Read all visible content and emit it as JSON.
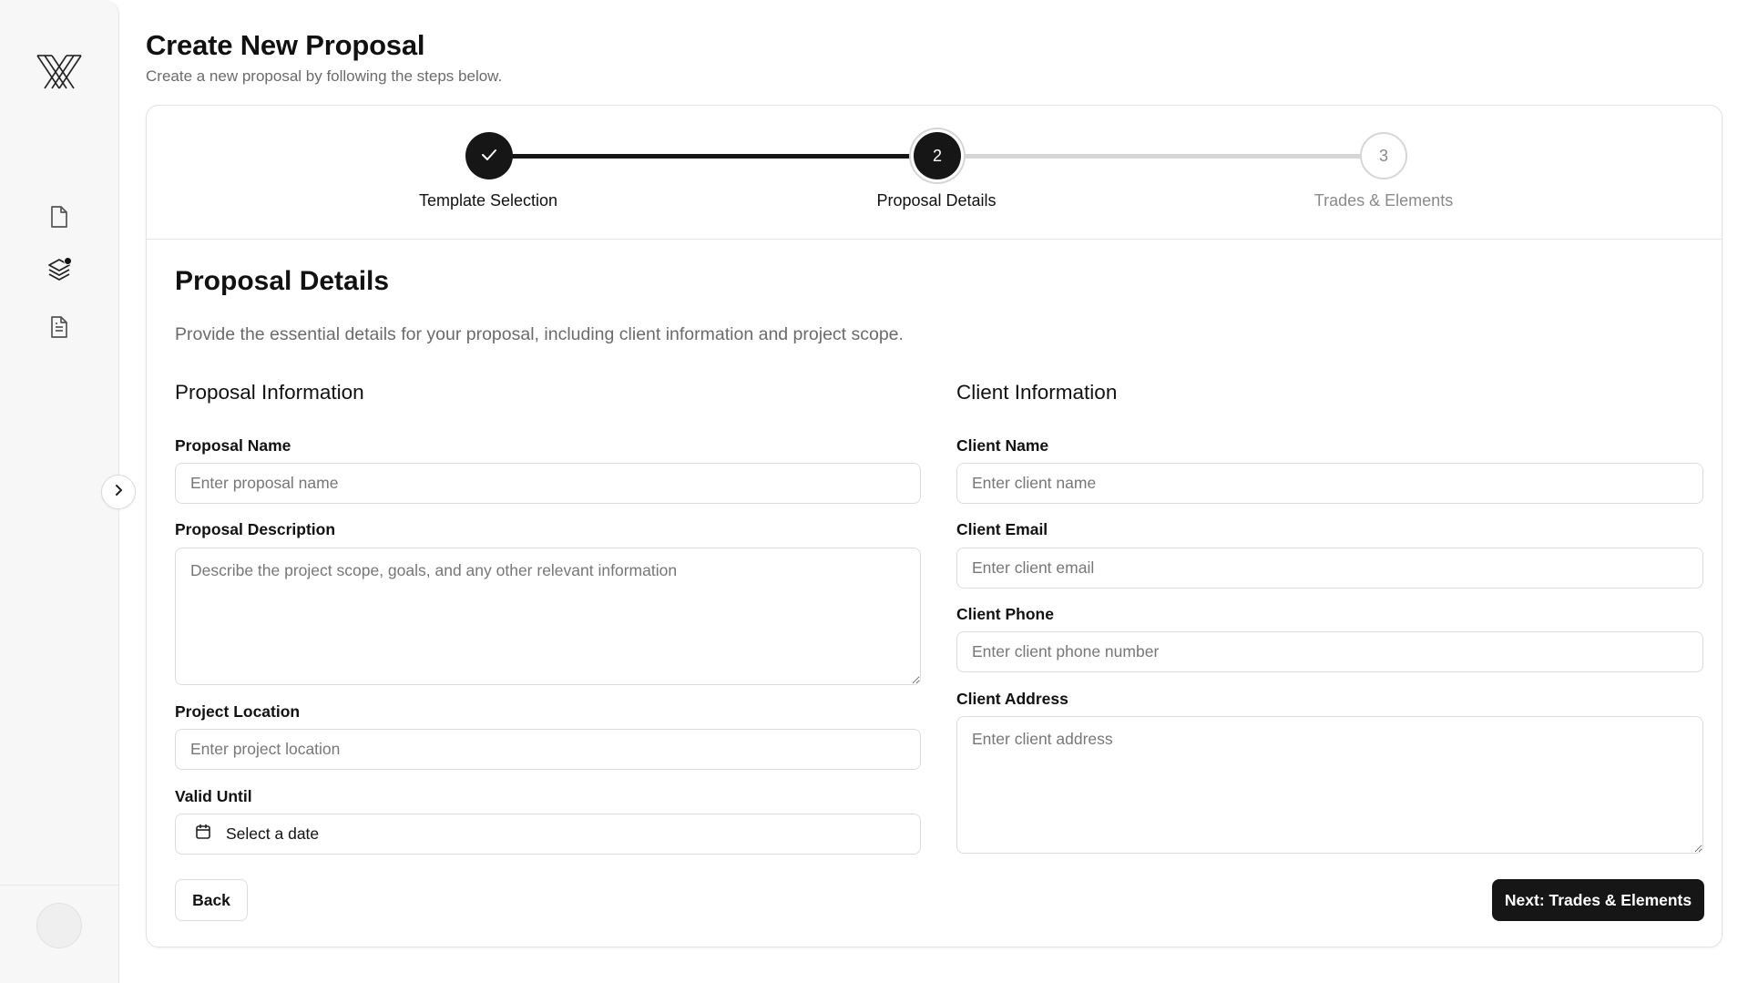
{
  "header": {
    "title": "Create New Proposal",
    "subtitle": "Create a new proposal by following the steps below."
  },
  "sidebar": {
    "logo_icon": "brand-logo-icon",
    "items": [
      {
        "icon": "file-icon",
        "name": "documents"
      },
      {
        "icon": "layers-icon",
        "name": "templates",
        "has_badge": true
      },
      {
        "icon": "file-text-icon",
        "name": "proposals"
      }
    ],
    "collapse_icon": "chevron-right-icon"
  },
  "stepper": {
    "steps": [
      {
        "number": "1",
        "label": "Template Selection",
        "state": "completed"
      },
      {
        "number": "2",
        "label": "Proposal Details",
        "state": "active"
      },
      {
        "number": "3",
        "label": "Trades & Elements",
        "state": "upcoming"
      }
    ]
  },
  "section": {
    "title": "Proposal Details",
    "description": "Provide the essential details for your proposal, including client information and project scope."
  },
  "proposal_info": {
    "title": "Proposal Information",
    "name_label": "Proposal Name",
    "name_placeholder": "Enter proposal name",
    "description_label": "Proposal Description",
    "description_placeholder": "Describe the project scope, goals, and any other relevant information",
    "location_label": "Project Location",
    "location_placeholder": "Enter project location",
    "valid_until_label": "Valid Until",
    "valid_until_value": "Select a date"
  },
  "client_info": {
    "title": "Client Information",
    "name_label": "Client Name",
    "name_placeholder": "Enter client name",
    "email_label": "Client Email",
    "email_placeholder": "Enter client email",
    "phone_label": "Client Phone",
    "phone_placeholder": "Enter client phone number",
    "address_label": "Client Address",
    "address_placeholder": "Enter client address"
  },
  "actions": {
    "back_label": "Back",
    "next_label": "Next: Trades & Elements"
  },
  "colors": {
    "primary": "#161616",
    "muted_text": "#6b6b6b",
    "border": "#dcdcdc",
    "inactive_step": "#d6d6d6"
  }
}
